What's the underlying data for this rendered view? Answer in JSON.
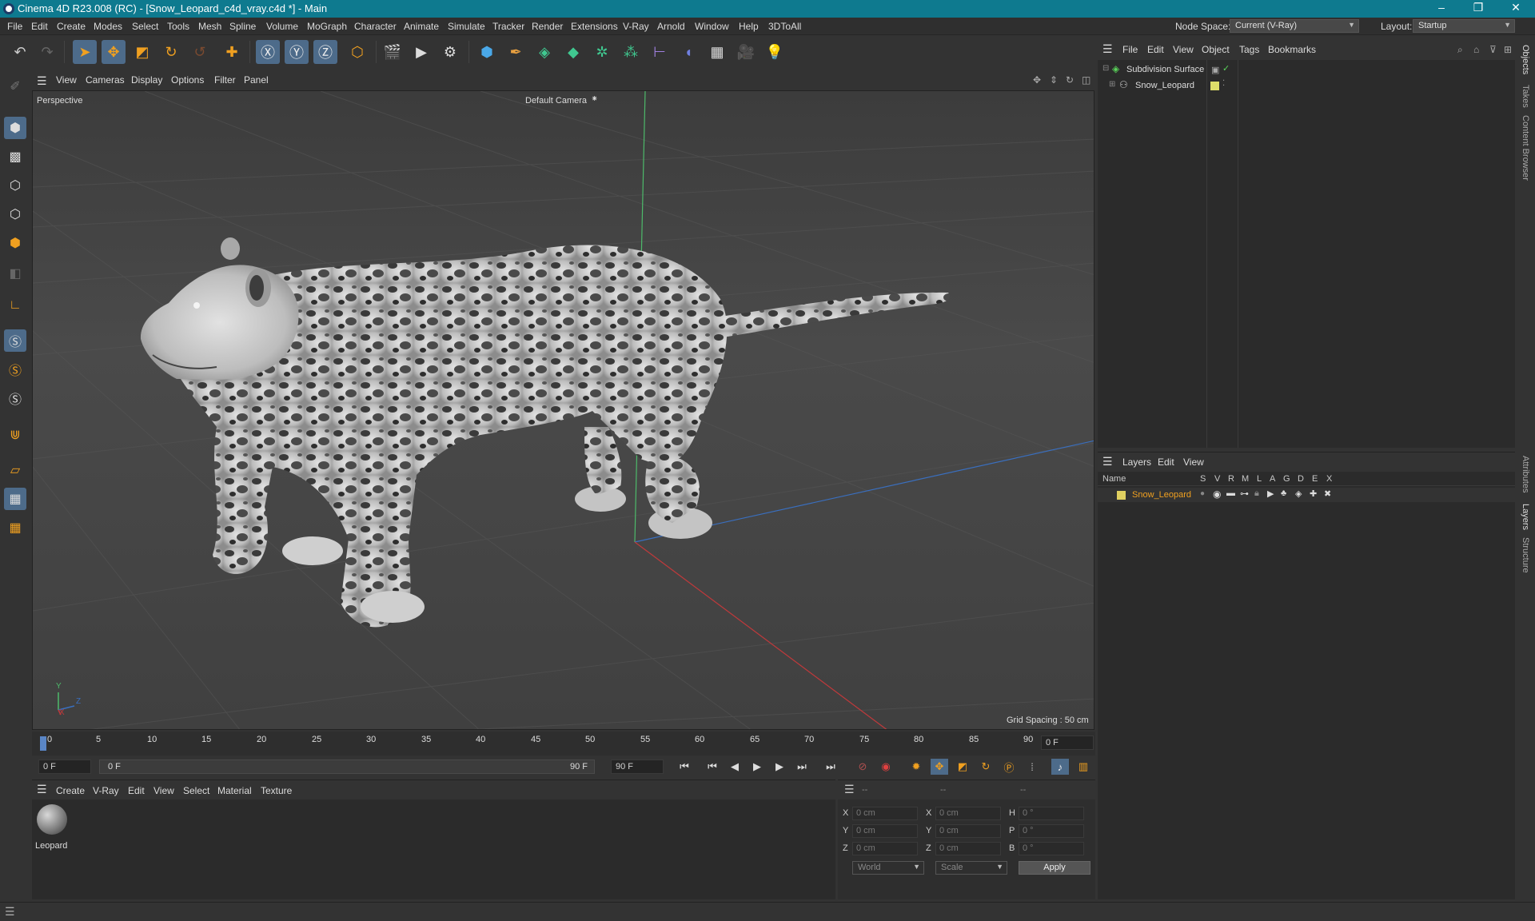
{
  "window": {
    "title": "Cinema 4D R23.008 (RC) - [Snow_Leopard_c4d_vray.c4d *] - Main",
    "controls": [
      "–",
      "❐",
      "✕"
    ]
  },
  "menubar": {
    "items": [
      "File",
      "Edit",
      "Create",
      "Modes",
      "Select",
      "Tools",
      "Mesh",
      "Spline",
      "Volume",
      "MoGraph",
      "Character",
      "Animate",
      "Simulate",
      "Tracker",
      "Render",
      "Extensions",
      "V-Ray",
      "Arnold",
      "Window",
      "Help",
      "3DToAll"
    ],
    "node_space_label": "Node Space:",
    "node_space_value": "Current (V-Ray)",
    "layout_label": "Layout:",
    "layout_value": "Startup"
  },
  "viewport": {
    "menu": [
      "View",
      "Cameras",
      "Display",
      "Options",
      "Filter",
      "Panel"
    ],
    "view_name": "Perspective",
    "camera": "Default Camera",
    "grid_spacing": "Grid Spacing : 50 cm",
    "axis_labels": {
      "y": "Y",
      "z": "Z",
      "x": "X"
    }
  },
  "timeline": {
    "ticks": [
      "0",
      "5",
      "10",
      "15",
      "20",
      "25",
      "30",
      "35",
      "40",
      "45",
      "50",
      "55",
      "60",
      "65",
      "70",
      "75",
      "80",
      "85",
      "90"
    ],
    "current_frame_right": "0 F",
    "start_field": "0 F",
    "range_start": "0 F",
    "range_end": "90 F",
    "end_field": "90 F"
  },
  "material_manager": {
    "menu": [
      "Create",
      "V-Ray",
      "Edit",
      "View",
      "Select",
      "Material",
      "Texture"
    ],
    "materials": [
      {
        "name": "Leopard"
      }
    ]
  },
  "coordinates": {
    "headers": [
      "--",
      "--",
      "--"
    ],
    "rows": [
      {
        "l1": "X",
        "v1": "0 cm",
        "l2": "X",
        "v2": "0 cm",
        "l3": "H",
        "v3": "0 °"
      },
      {
        "l1": "Y",
        "v1": "0 cm",
        "l2": "Y",
        "v2": "0 cm",
        "l3": "P",
        "v3": "0 °"
      },
      {
        "l1": "Z",
        "v1": "0 cm",
        "l2": "Z",
        "v2": "0 cm",
        "l3": "B",
        "v3": "0 °"
      }
    ],
    "mode": "World",
    "transform": "Scale",
    "apply_label": "Apply"
  },
  "object_manager": {
    "menu": [
      "File",
      "Edit",
      "View",
      "Object",
      "Tags",
      "Bookmarks"
    ],
    "objects": [
      {
        "name": "Subdivision Surface",
        "color": "#5ad45a"
      },
      {
        "name": "Snow_Leopard",
        "color": "#dede6a"
      }
    ]
  },
  "layer_manager": {
    "menu": [
      "Layers",
      "Edit",
      "View"
    ],
    "columns": [
      "Name",
      "S",
      "V",
      "R",
      "M",
      "L",
      "A",
      "G",
      "D",
      "E",
      "X"
    ],
    "layers": [
      {
        "name": "Snow_Leopard",
        "color": "#e0d060"
      }
    ]
  },
  "side_tabs": [
    "Objects",
    "Takes",
    "Content Browser",
    "Attributes",
    "Layers",
    "Structure"
  ]
}
